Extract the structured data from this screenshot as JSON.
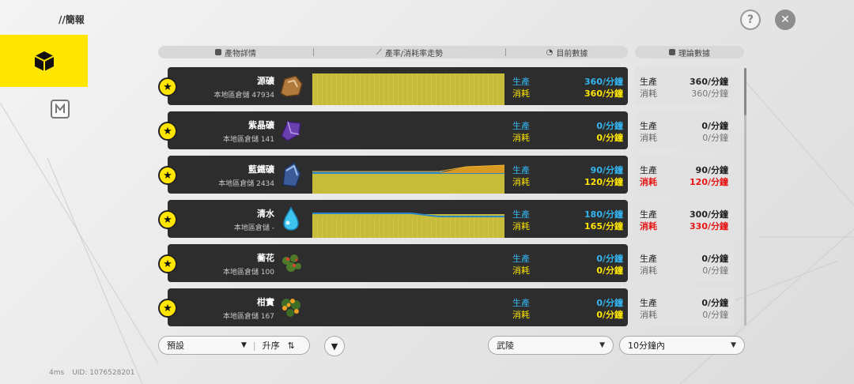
{
  "top": {
    "title": "//簡報",
    "help_icon": "?",
    "close_icon": "✕"
  },
  "side_nav": {
    "active_icon": "cube-icon",
    "second_icon": "route-icon"
  },
  "table_header": {
    "col_product": "產物詳情",
    "col_trend": "產率/消耗率走勢",
    "col_current": "目前數據",
    "col_theory": "理論數據"
  },
  "labels": {
    "produce": "生產",
    "consume": "消耗"
  },
  "rows": [
    {
      "name": "源礦",
      "stock": "本地區倉儲 47934",
      "icon": "ore-icon",
      "cur_prod": "360/分鐘",
      "cur_cons": "360/分鐘",
      "th_prod": "360/分鐘",
      "th_cons": "360/分鐘",
      "th_cons_red": false,
      "has_chart": true,
      "chart_prod_fraction": [
        1.0,
        1.0
      ],
      "chart_cons_fraction": [
        1.0,
        1.0
      ]
    },
    {
      "name": "紫晶礦",
      "stock": "本地區倉儲 141",
      "icon": "amethyst-icon",
      "cur_prod": "0/分鐘",
      "cur_cons": "0/分鐘",
      "th_prod": "0/分鐘",
      "th_cons": "0/分鐘",
      "th_cons_red": false,
      "has_chart": false
    },
    {
      "name": "藍鐵礦",
      "stock": "本地區倉儲 2434",
      "icon": "blue-iron-icon",
      "cur_prod": "90/分鐘",
      "cur_cons": "120/分鐘",
      "th_prod": "90/分鐘",
      "th_cons": "120/分鐘",
      "th_cons_red": true,
      "has_chart": true
    },
    {
      "name": "清水",
      "stock": "本地區倉儲 -",
      "icon": "water-icon",
      "cur_prod": "180/分鐘",
      "cur_cons": "165/分鐘",
      "th_prod": "300/分鐘",
      "th_cons": "330/分鐘",
      "th_cons_red": true,
      "has_chart": true
    },
    {
      "name": "蕎花",
      "stock": "本地區倉儲 100",
      "icon": "plant-icon",
      "cur_prod": "0/分鐘",
      "cur_cons": "0/分鐘",
      "th_prod": "0/分鐘",
      "th_cons": "0/分鐘",
      "th_cons_red": false,
      "has_chart": false
    },
    {
      "name": "柑實",
      "stock": "本地區倉儲 167",
      "icon": "fruit-icon",
      "cur_prod": "0/分鐘",
      "cur_cons": "0/分鐘",
      "th_prod": "0/分鐘",
      "th_cons": "0/分鐘",
      "th_cons_red": false,
      "has_chart": false
    }
  ],
  "bottom": {
    "sort_preset": "預設",
    "sort_order": "升序",
    "region": "武陵",
    "time_range": "10分鐘內"
  },
  "status": {
    "ping": "4ms",
    "uid": "UID: 1076528201"
  },
  "colors": {
    "accent": "#ffe600",
    "produce": "#33b5f0",
    "red": "#e81414",
    "card": "#2d2d2d"
  }
}
